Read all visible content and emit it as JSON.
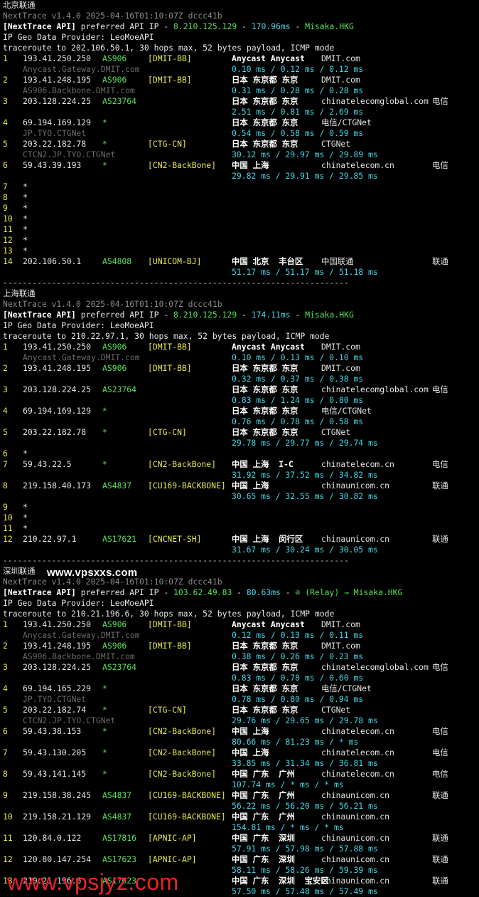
{
  "colors": {
    "bg": "#000000",
    "text": "#d8d8d8",
    "asn": "#59e05a",
    "tag": "#e8e84a",
    "latency": "#45d6e8",
    "dim": "#8a8a8a"
  },
  "blocks": [
    {
      "title": "北京联通",
      "version_line": "NextTrace v1.4.0 2025-04-16T01:10:07Z dccc41b",
      "api_prefix": "[NextTrace API]",
      "api_mid": " preferred API IP - ",
      "api_ip": "8.210.125.129",
      "api_sep": " - ",
      "api_ms": "170.96ms",
      "api_sep2": " - ",
      "api_host": "Misaka.HKG",
      "geo_line": "IP Geo Data Provider: LeoMoeAPI",
      "trace_line": "traceroute to 202.106.50.1, 30 hops max, 52 bytes payload, ICMP mode",
      "hops": [
        {
          "n": "1",
          "ip": "193.41.250.250",
          "asn": "AS906",
          "tag": "[DMIT-BB]",
          "loc": "Anycast Anycast",
          "isp": "DMIT.com",
          "cn": "",
          "host": "Anycast.Gateway.DMIT.com",
          "lat": "0.10 ms / 0.12 ms / 0.12 ms"
        },
        {
          "n": "2",
          "ip": "193.41.248.195",
          "asn": "AS906",
          "tag": "[DMIT-BB]",
          "loc": "日本 东京都 东京",
          "isp": "DMIT.com",
          "cn": "",
          "host": "AS906.Backbone.DMIT.com",
          "lat": "0.31 ms / 0.28 ms / 0.28 ms"
        },
        {
          "n": "3",
          "ip": "203.128.224.25",
          "asn": "AS23764",
          "tag": "",
          "loc": "日本 东京都 东京",
          "isp": "chinatelecomglobal.com",
          "cn": "电信",
          "host": "",
          "lat": "2.51 ms / 0.81 ms / 2.69 ms"
        },
        {
          "n": "4",
          "ip": "69.194.169.129",
          "asn": "*",
          "tag": "",
          "loc": "日本 东京都 东京",
          "isp": "电信/CTGNet",
          "cn": "",
          "host": "JP.TYO.CTGNet",
          "lat": "0.54 ms / 0.58 ms / 0.59 ms"
        },
        {
          "n": "5",
          "ip": "203.22.182.78",
          "asn": "*",
          "tag": "[CTG-CN]",
          "loc": "日本 东京都 东京",
          "isp": "CTGNet",
          "cn": "",
          "host": "CTCN2.JP.TYO.CTGNet",
          "lat": "30.12 ms / 29.97 ms / 29.89 ms"
        },
        {
          "n": "6",
          "ip": "59.43.39.193",
          "asn": "*",
          "tag": "[CN2-BackBone]",
          "loc": "中国 上海",
          "isp": "chinatelecom.cn",
          "cn": "电信",
          "host": "",
          "lat": "29.82 ms / 29.91 ms / 29.85 ms"
        },
        {
          "n": "7",
          "ip": "*"
        },
        {
          "n": "8",
          "ip": "*"
        },
        {
          "n": "9",
          "ip": "*"
        },
        {
          "n": "10",
          "ip": "*"
        },
        {
          "n": "11",
          "ip": "*"
        },
        {
          "n": "12",
          "ip": "*"
        },
        {
          "n": "13",
          "ip": "*"
        },
        {
          "n": "14",
          "ip": "202.106.50.1",
          "asn": "AS4808",
          "tag": "[UNICOM-BJ]",
          "loc": "中国 北京  丰台区",
          "isp": "中国联通",
          "cn": "联通",
          "host": "",
          "lat": "51.17 ms / 51.17 ms / 51.18 ms"
        }
      ]
    },
    {
      "title": "上海联通",
      "version_line": "NextTrace v1.4.0 2025-04-16T01:10:07Z dccc41b",
      "api_prefix": "[NextTrace API]",
      "api_mid": " preferred API IP - ",
      "api_ip": "8.210.125.129",
      "api_sep": " - ",
      "api_ms": "174.11ms",
      "api_sep2": " - ",
      "api_host": "Misaka.HKG",
      "geo_line": "IP Geo Data Provider: LeoMoeAPI",
      "trace_line": "traceroute to 210.22.97.1, 30 hops max, 52 bytes payload, ICMP mode",
      "hops": [
        {
          "n": "1",
          "ip": "193.41.250.250",
          "asn": "AS906",
          "tag": "[DMIT-BB]",
          "loc": "Anycast Anycast",
          "isp": "DMIT.com",
          "cn": "",
          "host": "Anycast.Gateway.DMIT.com",
          "lat": "0.10 ms / 0.13 ms / 0.10 ms"
        },
        {
          "n": "2",
          "ip": "193.41.248.195",
          "asn": "AS906",
          "tag": "[DMIT-BB]",
          "loc": "日本 东京都 东京",
          "isp": "DMIT.com",
          "cn": "",
          "host": "",
          "lat": "0.32 ms / 0.37 ms / 0.38 ms"
        },
        {
          "n": "3",
          "ip": "203.128.224.25",
          "asn": "AS23764",
          "tag": "",
          "loc": "日本 东京都 东京",
          "isp": "chinatelecomglobal.com",
          "cn": "电信",
          "host": "",
          "lat": "0.83 ms / 1.24 ms / 0.80 ms"
        },
        {
          "n": "4",
          "ip": "69.194.169.129",
          "asn": "*",
          "tag": "",
          "loc": "日本 东京都 东京",
          "isp": "电信/CTGNet",
          "cn": "",
          "host": "",
          "lat": "0.76 ms / 0.78 ms / 0.58 ms"
        },
        {
          "n": "5",
          "ip": "203.22.182.78",
          "asn": "*",
          "tag": "[CTG-CN]",
          "loc": "日本 东京都 东京",
          "isp": "CTGNet",
          "cn": "",
          "host": "",
          "lat": "29.78 ms / 29.77 ms / 29.74 ms"
        },
        {
          "n": "6",
          "ip": "*"
        },
        {
          "n": "7",
          "ip": "59.43.22.5",
          "asn": "*",
          "tag": "[CN2-BackBone]",
          "loc": "中国 上海  I-C",
          "isp": "chinatelecom.cn",
          "cn": "电信",
          "host": "",
          "lat": "31.92 ms / 37.52 ms / 34.82 ms"
        },
        {
          "n": "8",
          "ip": "219.158.40.173",
          "asn": "AS4837",
          "tag": "[CU169-BACKBONE]",
          "loc": "中国 上海",
          "isp": "chinaunicom.cn",
          "cn": "联通",
          "host": "",
          "lat": "30.65 ms / 32.55 ms / 30.82 ms"
        },
        {
          "n": "9",
          "ip": "*"
        },
        {
          "n": "10",
          "ip": "*"
        },
        {
          "n": "11",
          "ip": "*"
        },
        {
          "n": "12",
          "ip": "210.22.97.1",
          "asn": "AS17621",
          "tag": "[CNCNET-SH]",
          "loc": "中国 上海  闵行区",
          "isp": "chinaunicom.cn",
          "cn": "联通",
          "host": "",
          "lat": "31.67 ms / 30.24 ms / 30.05 ms"
        }
      ]
    },
    {
      "title": "深圳联通",
      "version_line": "NextTrace v1.4.0 2025-04-16T01:10:07Z dccc41b",
      "api_prefix": "[NextTrace API]",
      "api_mid": " preferred API IP - ",
      "api_ip": "103.62.49.83",
      "api_sep": " - ",
      "api_ms": "80.63ms",
      "api_sep2": " - ",
      "api_host": "✇ (Relay) → Misaka.HKG",
      "geo_line": "IP Geo Data Provider: LeoMoeAPI",
      "trace_line": "traceroute to 210.21.196.6, 30 hops max, 52 bytes payload, ICMP mode",
      "hops": [
        {
          "n": "1",
          "ip": "193.41.250.250",
          "asn": "AS906",
          "tag": "[DMIT-BB]",
          "loc": "Anycast Anycast",
          "isp": "DMIT.com",
          "cn": "",
          "host": "Anycast.Gateway.DMIT.com",
          "lat": "0.12 ms / 0.13 ms / 0.11 ms"
        },
        {
          "n": "2",
          "ip": "193.41.248.195",
          "asn": "AS906",
          "tag": "[DMIT-BB]",
          "loc": "日本 东京都 东京",
          "isp": "DMIT.com",
          "cn": "",
          "host": "AS906.Backbone.DMIT.com",
          "lat": "0.38 ms / 0.26 ms / 0.23 ms"
        },
        {
          "n": "3",
          "ip": "203.128.224.25",
          "asn": "AS23764",
          "tag": "",
          "loc": "日本 东京都 东京",
          "isp": "chinatelecomglobal.com",
          "cn": "电信",
          "host": "",
          "lat": "0.83 ms / 0.78 ms / 0.60 ms"
        },
        {
          "n": "4",
          "ip": "69.194.165.229",
          "asn": "*",
          "tag": "",
          "loc": "日本 东京都 东京",
          "isp": "电信/CTGNet",
          "cn": "",
          "host": "JP.TYO.CTGNet",
          "lat": "0.78 ms / 0.80 ms / 0.94 ms"
        },
        {
          "n": "5",
          "ip": "203.22.182.74",
          "asn": "*",
          "tag": "[CTG-CN]",
          "loc": "日本 东京都 东京",
          "isp": "CTGNet",
          "cn": "",
          "host": "CTCN2.JP.TYO.CTGNet",
          "lat": "29.76 ms / 29.65 ms / 29.78 ms"
        },
        {
          "n": "6",
          "ip": "59.43.38.153",
          "asn": "*",
          "tag": "[CN2-BackBone]",
          "loc": "中国 上海",
          "isp": "chinatelecom.cn",
          "cn": "电信",
          "host": "",
          "lat": "80.66 ms / 81.23 ms / * ms"
        },
        {
          "n": "7",
          "ip": "59.43.130.205",
          "asn": "*",
          "tag": "[CN2-BackBone]",
          "loc": "中国 上海",
          "isp": "chinatelecom.cn",
          "cn": "电信",
          "host": "",
          "lat": "33.85 ms / 31.34 ms / 36.81 ms"
        },
        {
          "n": "8",
          "ip": "59.43.141.145",
          "asn": "*",
          "tag": "[CN2-BackBone]",
          "loc": "中国 广东  广州",
          "isp": "chinatelecom.cn",
          "cn": "电信",
          "host": "",
          "lat": "107.74 ms / * ms / * ms"
        },
        {
          "n": "9",
          "ip": "219.158.38.245",
          "asn": "AS4837",
          "tag": "[CU169-BACKBONE]",
          "loc": "中国 广东  广州",
          "isp": "chinaunicom.cn",
          "cn": "联通",
          "host": "",
          "lat": "56.22 ms / 56.20 ms / 56.21 ms"
        },
        {
          "n": "10",
          "ip": "219.158.21.129",
          "asn": "AS4837",
          "tag": "[CU169-BACKBONE]",
          "loc": "中国 广东  广州",
          "isp": "chinaunicom.cn",
          "cn": "",
          "host": "",
          "lat": "154.81 ms / * ms / * ms"
        },
        {
          "n": "11",
          "ip": "120.84.0.122",
          "asn": "AS17816",
          "tag": "[APNIC-AP]",
          "loc": "中国 广东  深圳",
          "isp": "chinaunicom.cn",
          "cn": "联通",
          "host": "",
          "lat": "57.91 ms / 57.98 ms / 57.88 ms"
        },
        {
          "n": "12",
          "ip": "120.80.147.254",
          "asn": "AS17623",
          "tag": "[APNIC-AP]",
          "loc": "中国 广东  深圳",
          "isp": "chinaunicom.cn",
          "cn": "联通",
          "host": "",
          "lat": "58.11 ms / 58.26 ms / 59.39 ms"
        },
        {
          "n": "13",
          "ip": "210.21.196.6",
          "asn": "AS17623",
          "tag": "",
          "loc": "中国 广东  深圳  宝安区",
          "isp": "chinaunicom.cn",
          "cn": "联通",
          "host": "",
          "lat": "57.50 ms / 57.48 ms / 57.49 ms"
        }
      ]
    }
  ],
  "separator": "-----------------------------------------------------------------------",
  "watermark_top": "www.vpsxxs.com",
  "watermark_bottom": "www.vpsjyz.com"
}
